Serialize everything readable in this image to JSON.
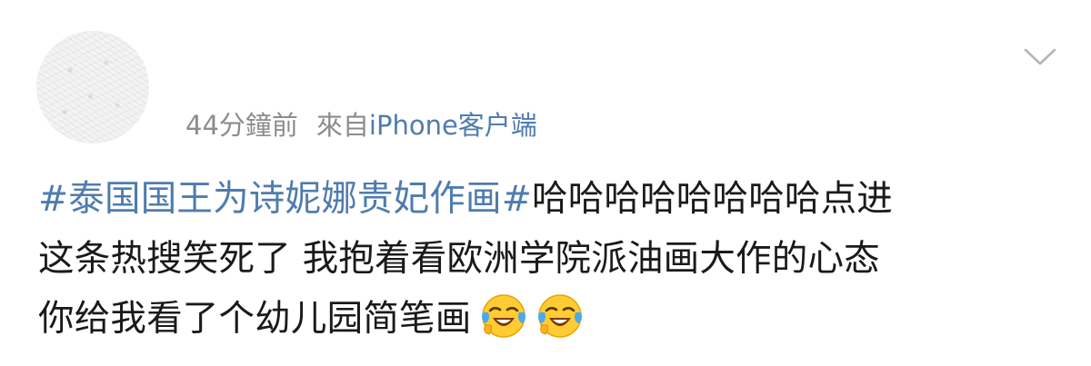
{
  "post": {
    "meta": {
      "time": "44分鐘前",
      "source_prefix": "來自",
      "source_link": "iPhone客户端"
    },
    "content": {
      "topic": "#泰国国王为诗妮娜贵妃作画#",
      "line1_rest": "哈哈哈哈哈哈哈哈点进",
      "line2": "这条热搜笑死了 我抱着看欧洲学院派油画大作的心态",
      "line3": "你给我看了个幼儿园简笔画"
    },
    "emojis": [
      "laughing-crying-emoji",
      "laughing-crying-emoji"
    ],
    "icons": {
      "expand": "chevron-down-icon"
    },
    "colors": {
      "link": "#4f7cae",
      "meta": "#8c8c8c",
      "text": "#1a1a1a"
    }
  }
}
